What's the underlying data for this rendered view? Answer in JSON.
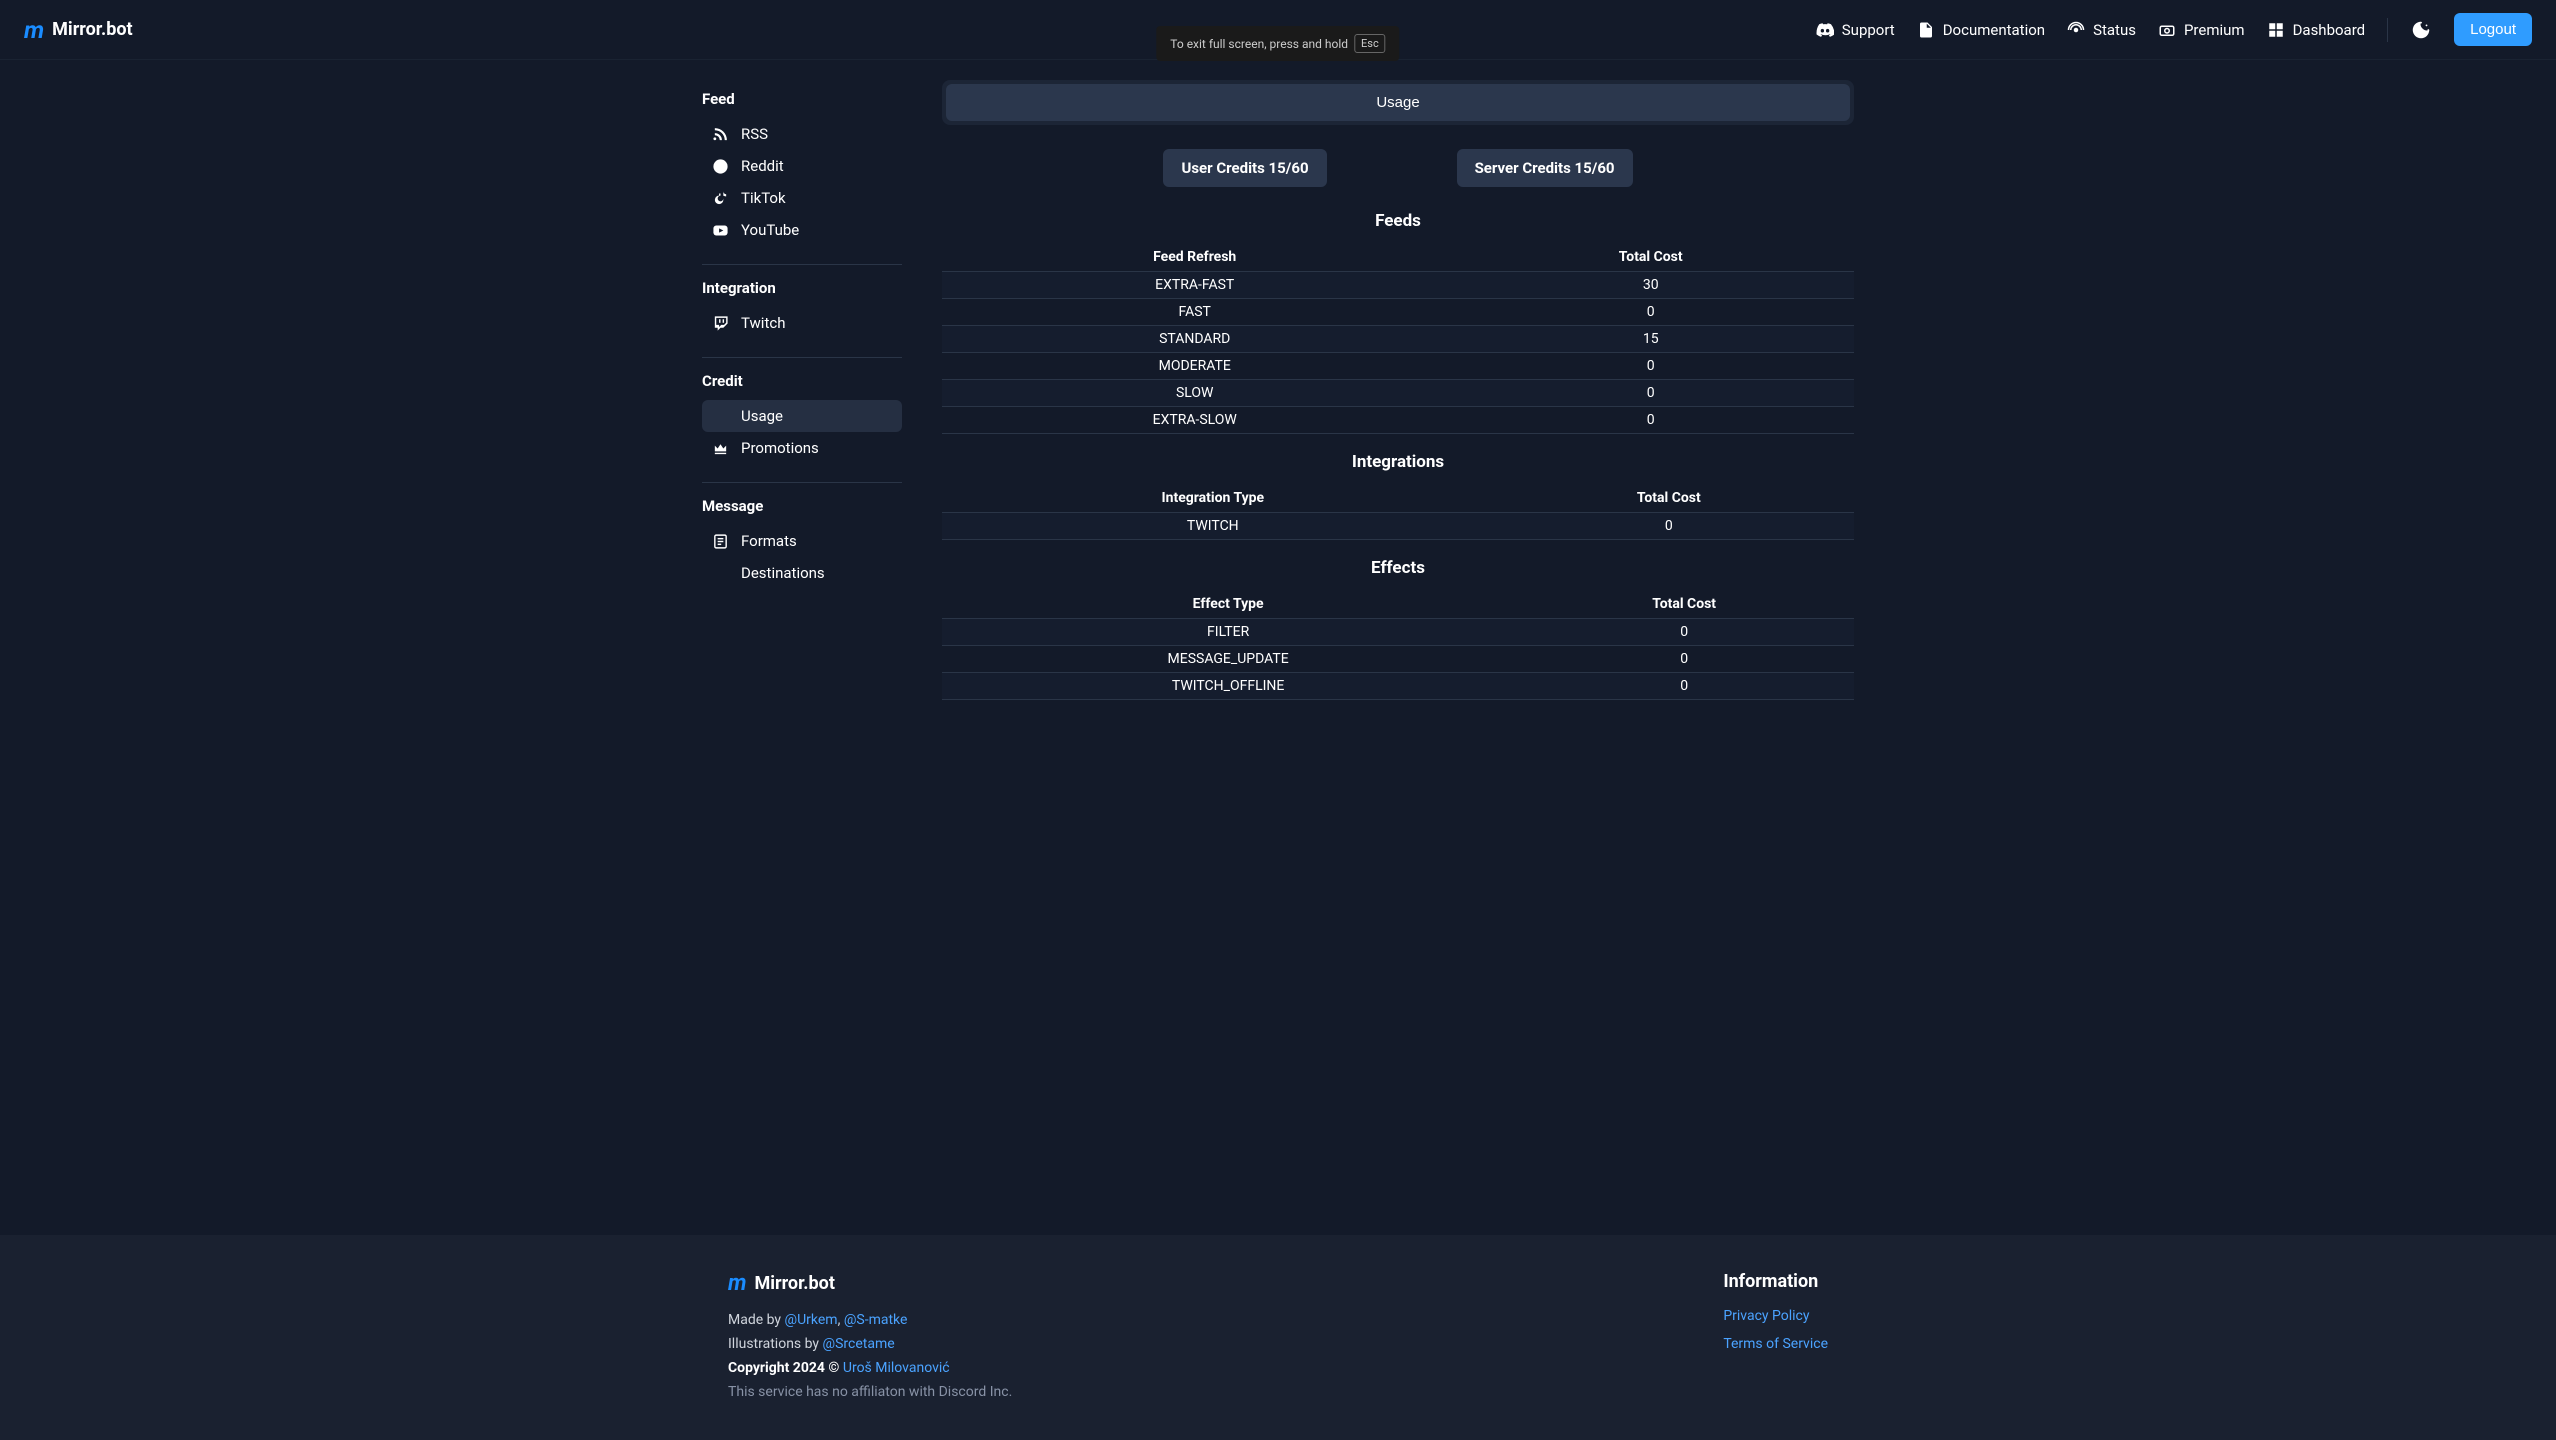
{
  "brand": "Mirror.bot",
  "header": {
    "nav": [
      {
        "id": "support",
        "label": "Support"
      },
      {
        "id": "documentation",
        "label": "Documentation"
      },
      {
        "id": "status",
        "label": "Status"
      },
      {
        "id": "premium",
        "label": "Premium"
      },
      {
        "id": "dashboard",
        "label": "Dashboard"
      }
    ],
    "logout": "Logout"
  },
  "fullscreen_banner": {
    "text": "To exit full screen, press and hold",
    "key": "Esc"
  },
  "sidebar": {
    "sections": [
      {
        "title": "Feed",
        "items": [
          {
            "id": "rss",
            "label": "RSS"
          },
          {
            "id": "reddit",
            "label": "Reddit"
          },
          {
            "id": "tiktok",
            "label": "TikTok"
          },
          {
            "id": "youtube",
            "label": "YouTube"
          }
        ]
      },
      {
        "title": "Integration",
        "items": [
          {
            "id": "twitch",
            "label": "Twitch"
          }
        ]
      },
      {
        "title": "Credit",
        "items": [
          {
            "id": "usage",
            "label": "Usage",
            "active": true
          },
          {
            "id": "promotions",
            "label": "Promotions"
          }
        ]
      },
      {
        "title": "Message",
        "items": [
          {
            "id": "formats",
            "label": "Formats"
          },
          {
            "id": "destinations",
            "label": "Destinations"
          }
        ]
      }
    ]
  },
  "content": {
    "tab": "Usage",
    "credits": {
      "user": "User Credits 15/60",
      "server": "Server Credits 15/60"
    },
    "tables": [
      {
        "title": "Feeds",
        "headers": [
          "Feed Refresh",
          "Total Cost"
        ],
        "rows": [
          [
            "EXTRA-FAST",
            "30"
          ],
          [
            "FAST",
            "0"
          ],
          [
            "STANDARD",
            "15"
          ],
          [
            "MODERATE",
            "0"
          ],
          [
            "SLOW",
            "0"
          ],
          [
            "EXTRA-SLOW",
            "0"
          ]
        ]
      },
      {
        "title": "Integrations",
        "headers": [
          "Integration Type",
          "Total Cost"
        ],
        "rows": [
          [
            "TWITCH",
            "0"
          ]
        ]
      },
      {
        "title": "Effects",
        "headers": [
          "Effect Type",
          "Total Cost"
        ],
        "rows": [
          [
            "FILTER",
            "0"
          ],
          [
            "MESSAGE_UPDATE",
            "0"
          ],
          [
            "TWITCH_OFFLINE",
            "0"
          ]
        ]
      }
    ]
  },
  "footer": {
    "made_by_prefix": "Made by ",
    "made_by_links": [
      "@Urkem",
      "@S-matke"
    ],
    "illustrations_prefix": "Illustrations by ",
    "illustrations_link": "@Srcetame",
    "copyright_prefix": "Copyright 2024 © ",
    "copyright_link": "Uroš Milovanović",
    "disclaimer": "This service has no affiliaton with Discord Inc.",
    "info_title": "Information",
    "info_links": [
      "Privacy Policy",
      "Terms of Service"
    ]
  }
}
